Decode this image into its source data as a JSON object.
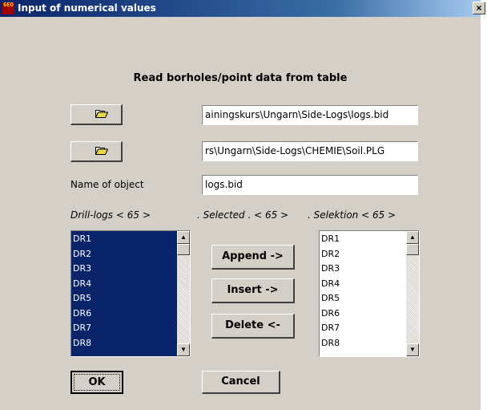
{
  "window": {
    "icon_text": "GEO",
    "title": "Input of numerical values",
    "close_label": "×"
  },
  "heading": "Read borholes/point data from table",
  "file1": {
    "value": "ainingskurs\\Ungarn\\Side-Logs\\logs.bid"
  },
  "file2": {
    "value": "rs\\Ungarn\\Side-Logs\\CHEMIE\\Soil.PLG"
  },
  "object": {
    "label": "Name of object",
    "value": "logs.bid"
  },
  "columns": {
    "drill_logs": "Drill-logs < 65 >",
    "selected": ". Selected . < 65 >",
    "selektion": ".   Selektion < 65 >"
  },
  "drill_logs": {
    "items": [
      "DR1",
      "DR2",
      "DR3",
      "DR4",
      "DR5",
      "DR6",
      "DR7",
      "DR8"
    ],
    "selection_color": "#0a246a"
  },
  "selektion": {
    "items": [
      "DR1",
      "DR2",
      "DR3",
      "DR4",
      "DR5",
      "DR6",
      "DR7",
      "DR8"
    ]
  },
  "buttons": {
    "append": "Append  ->",
    "insert": "Insert    ->",
    "delete": "Delete   <-",
    "ok": "OK",
    "cancel": "Cancel"
  },
  "scroll": {
    "up": "▲",
    "down": "▼"
  }
}
